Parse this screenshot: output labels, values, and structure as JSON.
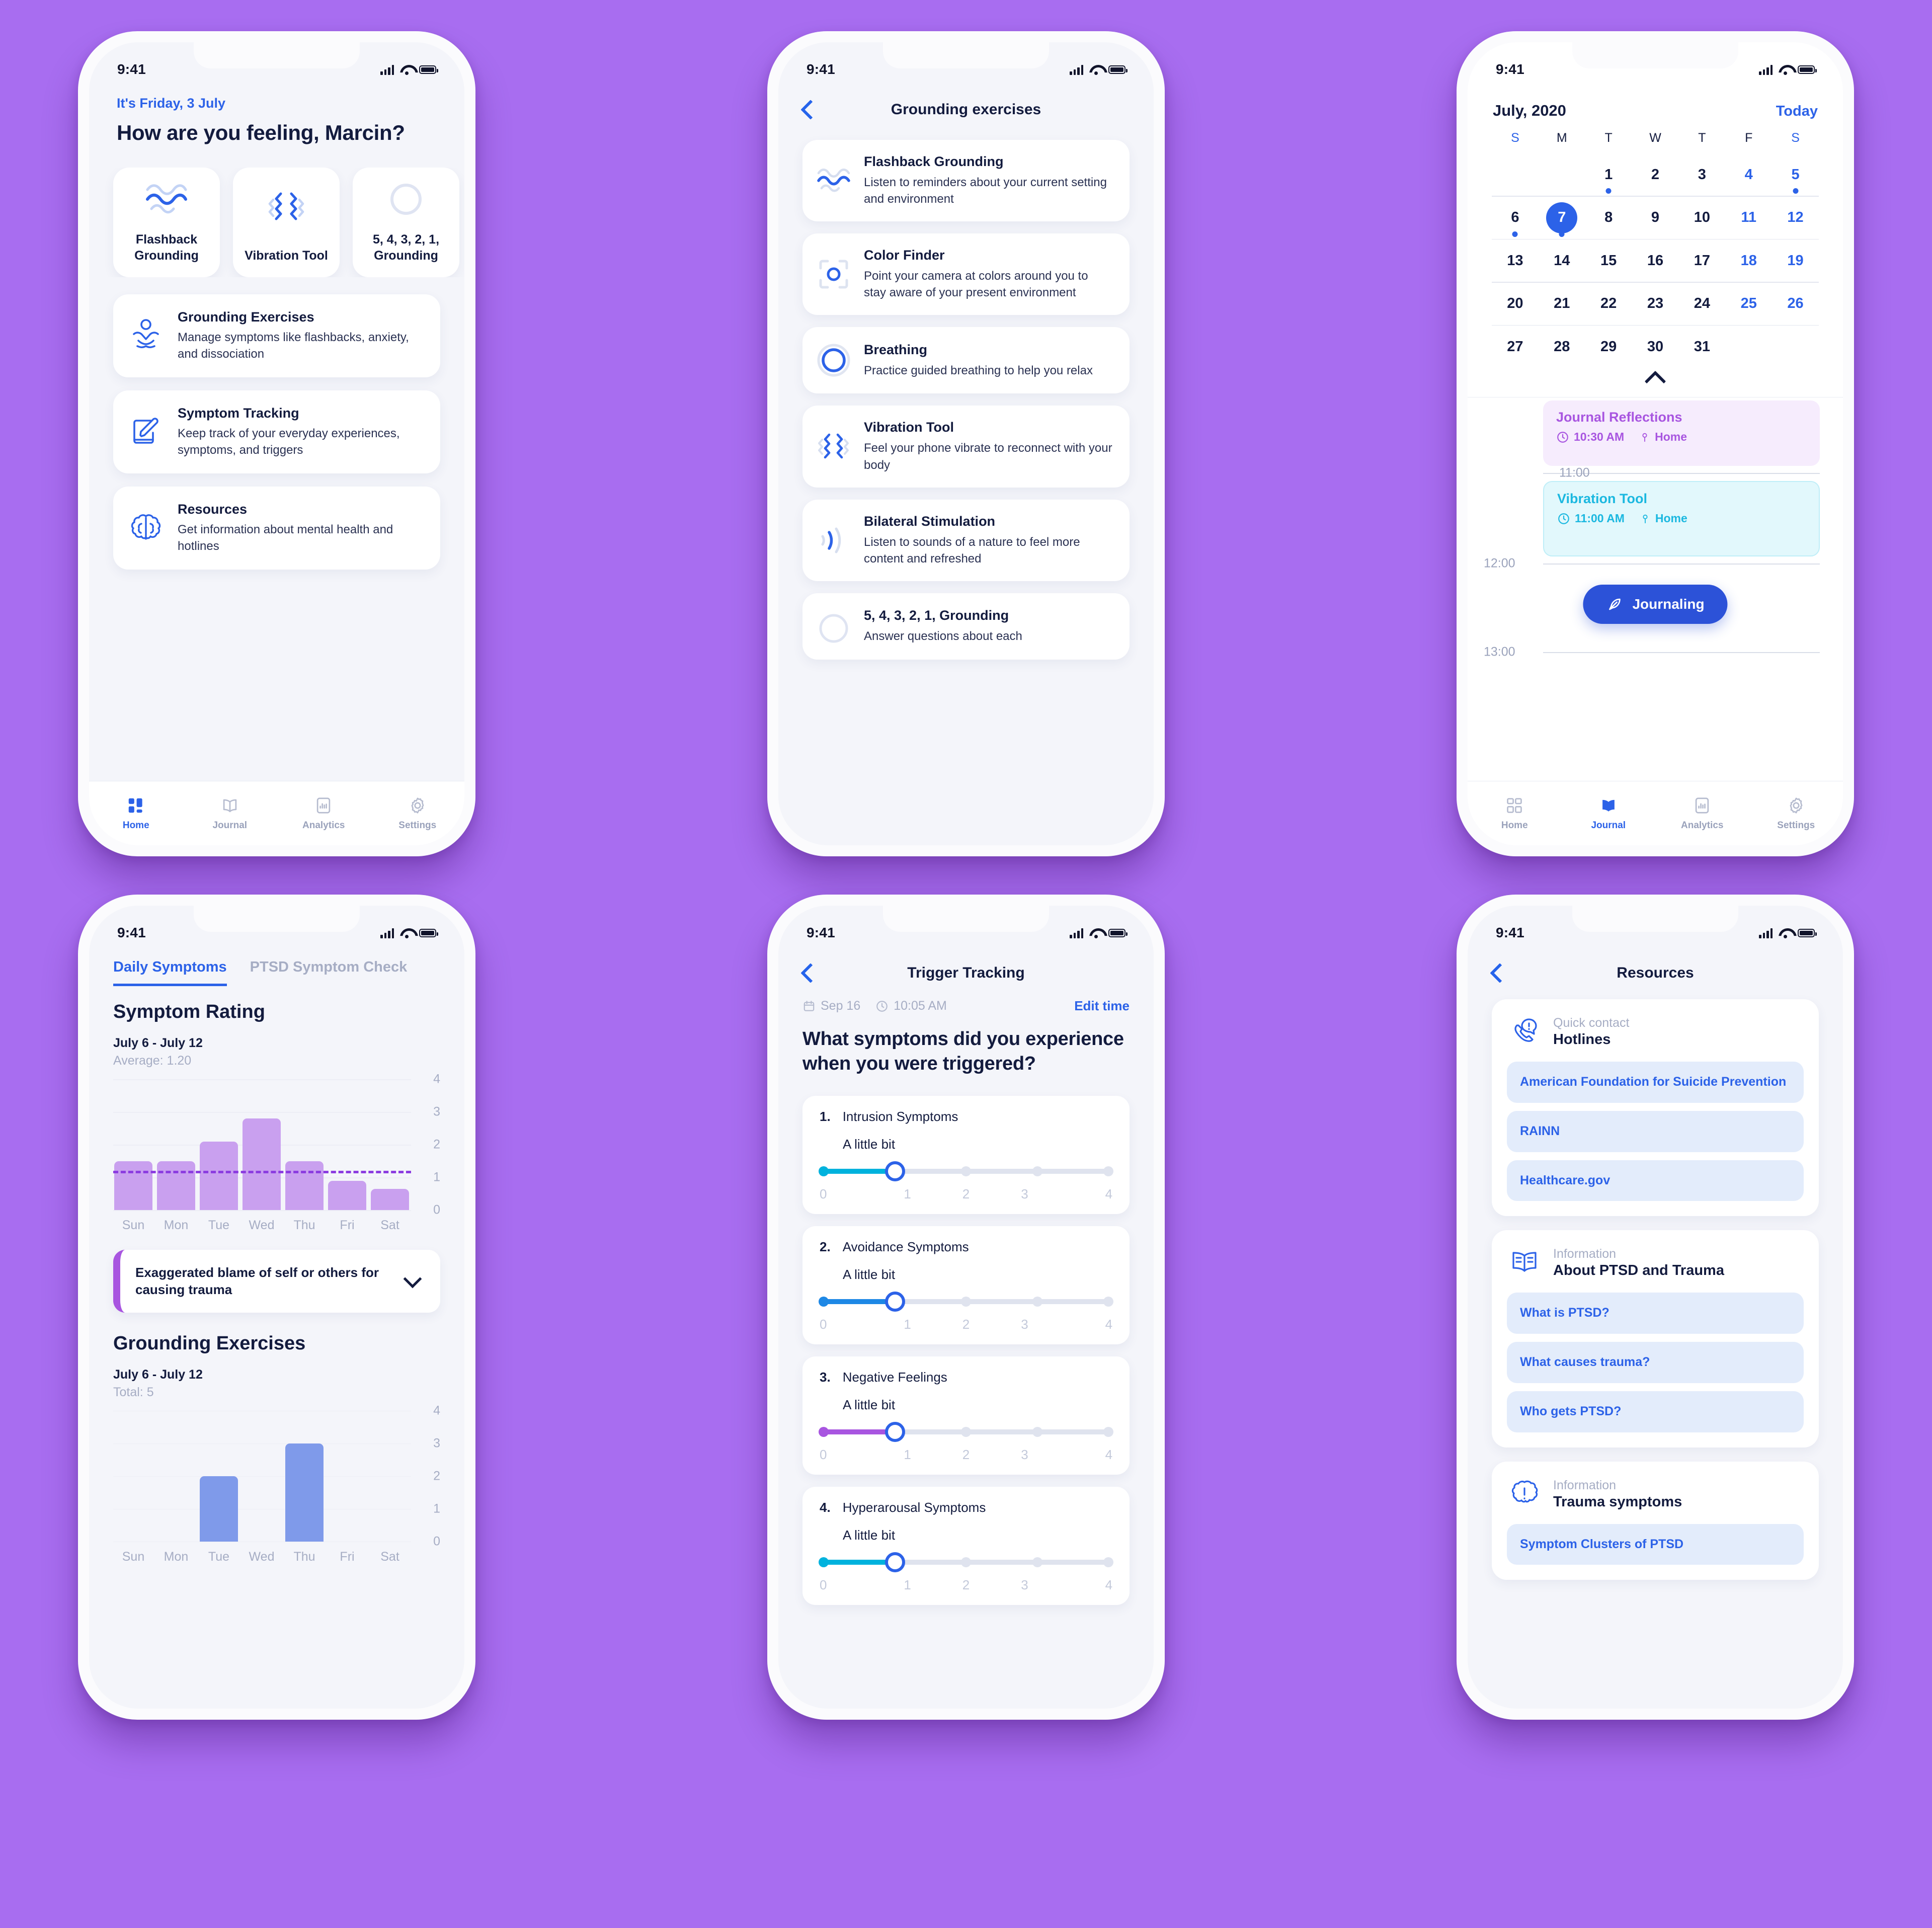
{
  "background_color": "#a86df0",
  "accent_blue": "#2c62e8",
  "status_bar": {
    "time": "9:41",
    "signal_icon": "cellular-bars-icon",
    "wifi_icon": "wifi-icon",
    "battery_icon": "battery-icon"
  },
  "tabbar": {
    "items": [
      {
        "label": "Home",
        "icon": "grid-icon"
      },
      {
        "label": "Journal",
        "icon": "book-icon"
      },
      {
        "label": "Analytics",
        "icon": "bar-chart-icon"
      },
      {
        "label": "Settings",
        "icon": "gear-icon"
      }
    ]
  },
  "home": {
    "date_line": "It's Friday, 3 July",
    "title": "How are you feeling, Marcin?",
    "tiles": [
      {
        "label": "Flashback Grounding",
        "icon": "waves-icon"
      },
      {
        "label": "Vibration Tool",
        "icon": "vibration-icon"
      },
      {
        "label": "5, 4, 3, 2, 1, Grounding",
        "icon": "circle-icon"
      }
    ],
    "cards": [
      {
        "title": "Grounding Exercises",
        "desc": "Manage symptoms like flashbacks, anxiety, and dissociation",
        "icon": "meditation-icon"
      },
      {
        "title": "Symptom Tracking",
        "desc": "Keep track of your everyday experiences, symptoms, and triggers",
        "icon": "notepad-pencil-icon"
      },
      {
        "title": "Resources",
        "desc": "Get information about mental health and hotlines",
        "icon": "brain-icon"
      }
    ],
    "active_tab": "Home"
  },
  "grounding": {
    "nav_title": "Grounding exercises",
    "items": [
      {
        "title": "Flashback Grounding",
        "desc": "Listen to reminders about your current setting and environment",
        "icon": "waves-icon"
      },
      {
        "title": "Color Finder",
        "desc": "Point your camera at colors around you to stay aware of your present environment",
        "icon": "camera-focus-icon"
      },
      {
        "title": "Breathing",
        "desc": "Practice guided breathing to help you relax",
        "icon": "breathing-circle-icon"
      },
      {
        "title": "Vibration Tool",
        "desc": "Feel your phone vibrate to reconnect with your body",
        "icon": "vibration-icon"
      },
      {
        "title": "Bilateral Stimulation",
        "desc": "Listen to sounds of a nature to feel more content and refreshed",
        "icon": "sound-waves-icon"
      },
      {
        "title": "5, 4, 3, 2, 1, Grounding",
        "desc": "Answer questions about each",
        "icon": "circle-icon"
      }
    ]
  },
  "journal": {
    "month": "July, 2020",
    "today_label": "Today",
    "day_names": [
      "S",
      "M",
      "T",
      "W",
      "T",
      "F",
      "S"
    ],
    "weeks": [
      [
        {
          "n": ""
        },
        {
          "n": ""
        },
        {
          "n": "1",
          "dot": true
        },
        {
          "n": "2"
        },
        {
          "n": "3"
        },
        {
          "n": "4",
          "wknd": true
        },
        {
          "n": "5",
          "wknd": true,
          "dot": true
        }
      ],
      [
        {
          "n": "6",
          "dot": true
        },
        {
          "n": "7",
          "sel": true,
          "dot": true
        },
        {
          "n": "8"
        },
        {
          "n": "9"
        },
        {
          "n": "10"
        },
        {
          "n": "11",
          "wknd": true
        },
        {
          "n": "12",
          "wknd": true
        }
      ],
      [
        {
          "n": "13"
        },
        {
          "n": "14"
        },
        {
          "n": "15"
        },
        {
          "n": "16"
        },
        {
          "n": "17"
        },
        {
          "n": "18",
          "wknd": true
        },
        {
          "n": "19",
          "wknd": true
        }
      ],
      [
        {
          "n": "20"
        },
        {
          "n": "21"
        },
        {
          "n": "22"
        },
        {
          "n": "23"
        },
        {
          "n": "24"
        },
        {
          "n": "25",
          "wknd": true
        },
        {
          "n": "26",
          "wknd": true
        }
      ],
      [
        {
          "n": "27"
        },
        {
          "n": "28"
        },
        {
          "n": "29"
        },
        {
          "n": "30"
        },
        {
          "n": "31"
        },
        {
          "n": ""
        },
        {
          "n": ""
        }
      ]
    ],
    "timeline_labels": [
      "11:00",
      "12:00",
      "13:00"
    ],
    "events": [
      {
        "title": "Journal Reflections",
        "time": "10:30 AM",
        "place": "Home",
        "color": "#a855e0",
        "bg": "#f6ecfd"
      },
      {
        "title": "Vibration Tool",
        "time": "11:00 AM",
        "place": "Home",
        "color": "#1bb8e0",
        "bg": "#e2f8fc"
      }
    ],
    "journaling_button": "Journaling",
    "journaling_icon": "feather-icon",
    "active_tab": "Journal"
  },
  "analytics": {
    "tabs": [
      {
        "label": "Daily Symptoms",
        "active": true
      },
      {
        "label": "PTSD Symptom Check",
        "active": false
      }
    ],
    "symptom_box": "Exaggerated blame of self or others for causing trauma",
    "chart_data": [
      {
        "type": "bar",
        "title": "Symptom Rating",
        "subtitle": "July 6 - July 12",
        "stat_label": "Average: 1.20",
        "categories": [
          "Sun",
          "Mon",
          "Tue",
          "Wed",
          "Thu",
          "Fri",
          "Sat"
        ],
        "values": [
          1.5,
          1.5,
          2.1,
          2.8,
          1.5,
          0.9,
          0.65
        ],
        "average": 1.2,
        "ylim": [
          0,
          4
        ],
        "yticks": [
          0,
          1,
          2,
          3,
          4
        ],
        "bar_color": "#c9a0ef",
        "average_line_color": "#8b3ce0",
        "grid": true,
        "xlabel": "",
        "ylabel": ""
      },
      {
        "type": "bar",
        "title": "Grounding Exercises",
        "subtitle": "July 6 - July 12",
        "stat_label": "Total: 5",
        "categories": [
          "Sun",
          "Mon",
          "Tue",
          "Wed",
          "Thu",
          "Fri",
          "Sat"
        ],
        "values": [
          0,
          0,
          2,
          0,
          3,
          0,
          0
        ],
        "ylim": [
          0,
          4
        ],
        "yticks": [
          0,
          1,
          2,
          3,
          4
        ],
        "bar_color": "#7f9aea",
        "grid": true,
        "xlabel": "",
        "ylabel": ""
      }
    ]
  },
  "trigger": {
    "nav_title": "Trigger Tracking",
    "date": "Sep 16",
    "time": "10:05 AM",
    "edit_label": "Edit time",
    "question": "What symptoms did you experience when you were triggered?",
    "scale": [
      "0",
      "1",
      "2",
      "3",
      "4"
    ],
    "questions": [
      {
        "num": "1.",
        "label": "Intrusion Symptoms",
        "value_label": "A little bit",
        "value": 1,
        "color": "#00b2dd"
      },
      {
        "num": "2.",
        "label": "Avoidance Symptoms",
        "value_label": "A little bit",
        "value": 1,
        "color": "#1e88e5"
      },
      {
        "num": "3.",
        "label": "Negative Feelings",
        "value_label": "A little bit",
        "value": 1,
        "color": "#a855e0"
      },
      {
        "num": "4.",
        "label": "Hyperarousal Symptoms",
        "value_label": "A little bit",
        "value": 1,
        "color": "#00b2dd"
      }
    ]
  },
  "resources": {
    "nav_title": "Resources",
    "sections": [
      {
        "kicker": "Quick contact",
        "title": "Hotlines",
        "icon": "phone-alert-icon",
        "links": [
          "American Foundation for Suicide Prevention",
          "RAINN",
          "Healthcare.gov"
        ]
      },
      {
        "kicker": "Information",
        "title": "About PTSD and Trauma",
        "icon": "open-book-icon",
        "links": [
          "What is PTSD?",
          "What causes trauma?",
          "Who gets PTSD?"
        ]
      },
      {
        "kicker": "Information",
        "title": "Trauma symptoms",
        "icon": "brain-alert-icon",
        "links": [
          "Symptom Clusters of PTSD"
        ]
      }
    ]
  }
}
